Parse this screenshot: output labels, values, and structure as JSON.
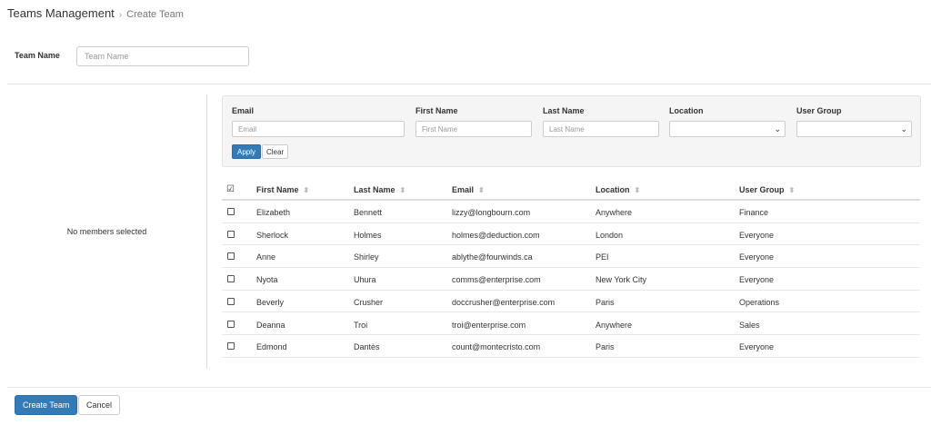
{
  "breadcrumb": {
    "root": "Teams Management",
    "separator": "›",
    "current": "Create Team"
  },
  "team_name": {
    "label": "Team Name",
    "value": "",
    "placeholder": "Team Name"
  },
  "members_panel": {
    "empty_text": "No members selected"
  },
  "filters": {
    "email": {
      "label": "Email",
      "value": "",
      "placeholder": "Email"
    },
    "first_name": {
      "label": "First Name",
      "value": "",
      "placeholder": "First Name"
    },
    "last_name": {
      "label": "Last Name",
      "value": "",
      "placeholder": "Last Name"
    },
    "location": {
      "label": "Location",
      "selected": ""
    },
    "user_group": {
      "label": "User Group",
      "selected": ""
    },
    "apply_label": "Apply",
    "clear_label": "Clear"
  },
  "table": {
    "columns": [
      "First Name",
      "Last Name",
      "Email",
      "Location",
      "User Group"
    ],
    "rows": [
      {
        "first": "Elizabeth",
        "last": "Bennett",
        "email": "lizzy@longbourn.com",
        "location": "Anywhere",
        "group": "Finance"
      },
      {
        "first": "Sherlock",
        "last": "Holmes",
        "email": "holmes@deduction.com",
        "location": "London",
        "group": "Everyone"
      },
      {
        "first": "Anne",
        "last": "Shirley",
        "email": "ablythe@fourwinds.ca",
        "location": "PEI",
        "group": "Everyone"
      },
      {
        "first": "Nyota",
        "last": "Uhura",
        "email": "comms@enterprise.com",
        "location": "New York City",
        "group": "Everyone"
      },
      {
        "first": "Beverly",
        "last": "Crusher",
        "email": "doccrusher@enterprise.com",
        "location": "Paris",
        "group": "Operations"
      },
      {
        "first": "Deanna",
        "last": "Troi",
        "email": "troi@enterprise.com",
        "location": "Anywhere",
        "group": "Sales"
      },
      {
        "first": "Edmond",
        "last": "Dantès",
        "email": "count@montecristo.com",
        "location": "Paris",
        "group": "Everyone"
      }
    ]
  },
  "footer": {
    "create_label": "Create Team",
    "cancel_label": "Cancel"
  },
  "colors": {
    "primary": "#337ab7",
    "panel_bg": "#f5f5f5",
    "border": "#cccccc"
  }
}
